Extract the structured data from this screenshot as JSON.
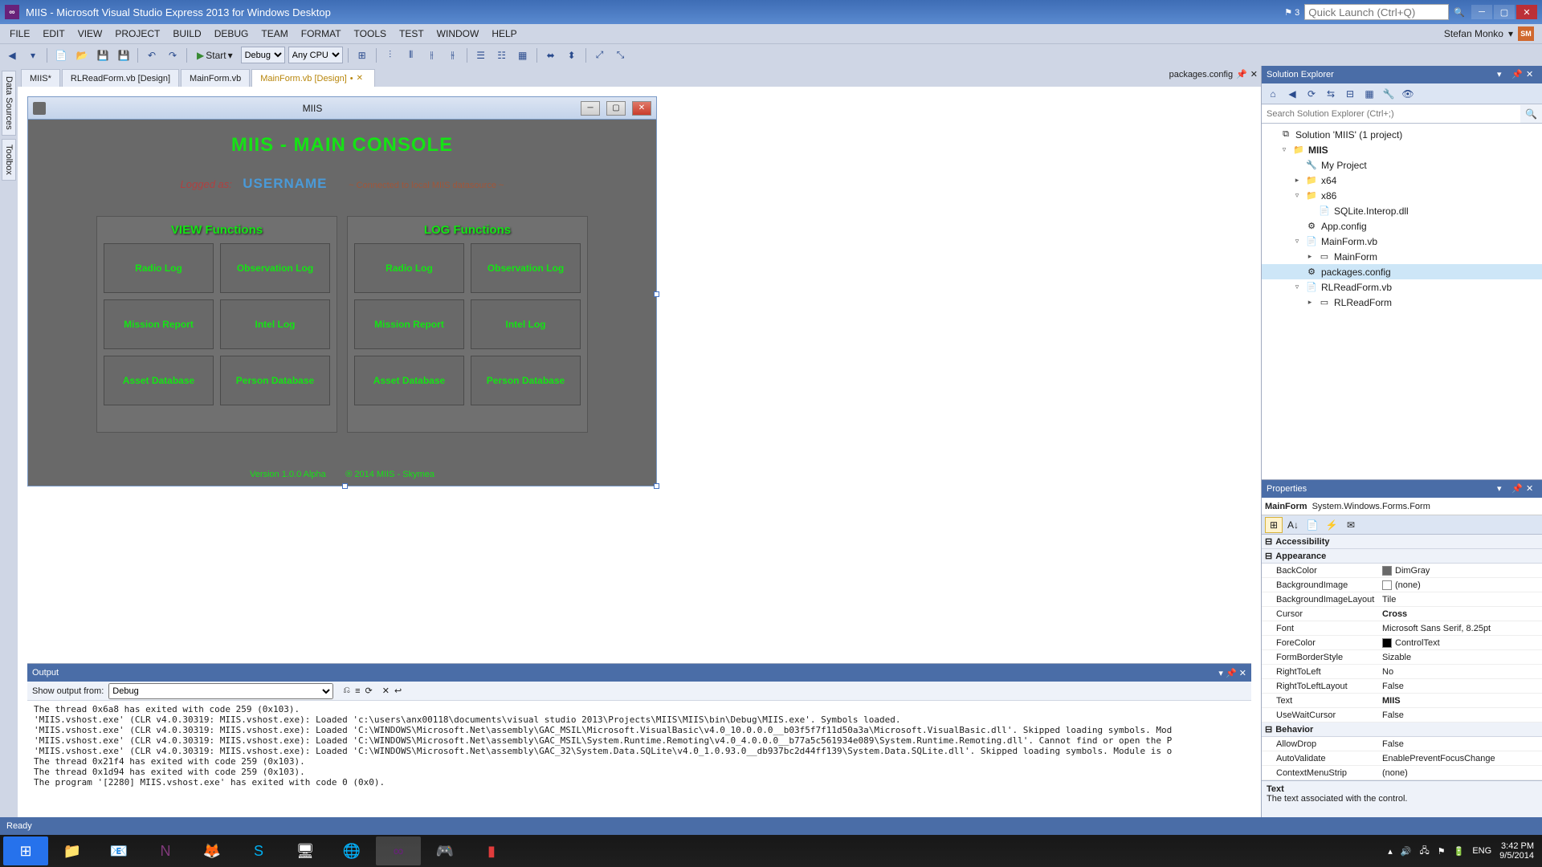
{
  "titlebar": {
    "title": "MIIS - Microsoft Visual Studio Express 2013 for Windows Desktop",
    "notif_count": "3",
    "quick_launch_placeholder": "Quick Launch (Ctrl+Q)"
  },
  "menubar": {
    "items": [
      "FILE",
      "EDIT",
      "VIEW",
      "PROJECT",
      "BUILD",
      "DEBUG",
      "TEAM",
      "FORMAT",
      "TOOLS",
      "TEST",
      "WINDOW",
      "HELP"
    ],
    "user": "Stefan Monko"
  },
  "toolbar": {
    "start": "Start",
    "config": "Debug",
    "platform": "Any CPU"
  },
  "side_tabs": [
    "Data Sources",
    "Toolbox"
  ],
  "doc_tabs": {
    "tabs": [
      {
        "label": "MIIS*"
      },
      {
        "label": "RLReadForm.vb [Design]"
      },
      {
        "label": "MainForm.vb"
      },
      {
        "label": "MainForm.vb [Design]",
        "active": true,
        "dirty": true
      }
    ],
    "right_file": "packages.config"
  },
  "form": {
    "title": "MIIS",
    "header": "MIIS - MAIN CONSOLE",
    "logged_as": "Logged as:",
    "username": "USERNAME",
    "datasource": "~ Connected to local MIIS datasource ~",
    "view_title": "VIEW Functions",
    "log_title": "LOG Functions",
    "buttons": [
      "Radio Log",
      "Observation Log",
      "Mission Report",
      "Intel Log",
      "Asset Database",
      "Person Database"
    ],
    "version": "Version 1.0.0 Alpha",
    "copyright": "® 2014 MIIS - Skymea"
  },
  "output": {
    "title": "Output",
    "show_label": "Show output from:",
    "source": "Debug",
    "lines": [
      "The thread 0x6a8 has exited with code 259 (0x103).",
      "'MIIS.vshost.exe' (CLR v4.0.30319: MIIS.vshost.exe): Loaded 'c:\\users\\anx00118\\documents\\visual studio 2013\\Projects\\MIIS\\MIIS\\bin\\Debug\\MIIS.exe'. Symbols loaded.",
      "'MIIS.vshost.exe' (CLR v4.0.30319: MIIS.vshost.exe): Loaded 'C:\\WINDOWS\\Microsoft.Net\\assembly\\GAC_MSIL\\Microsoft.VisualBasic\\v4.0_10.0.0.0__b03f5f7f11d50a3a\\Microsoft.VisualBasic.dll'. Skipped loading symbols. Mod",
      "'MIIS.vshost.exe' (CLR v4.0.30319: MIIS.vshost.exe): Loaded 'C:\\WINDOWS\\Microsoft.Net\\assembly\\GAC_MSIL\\System.Runtime.Remoting\\v4.0_4.0.0.0__b77a5c561934e089\\System.Runtime.Remoting.dll'. Cannot find or open the P",
      "'MIIS.vshost.exe' (CLR v4.0.30319: MIIS.vshost.exe): Loaded 'C:\\WINDOWS\\Microsoft.Net\\assembly\\GAC_32\\System.Data.SQLite\\v4.0_1.0.93.0__db937bc2d44ff139\\System.Data.SQLite.dll'. Skipped loading symbols. Module is o",
      "The thread 0x21f4 has exited with code 259 (0x103).",
      "The thread 0x1d94 has exited with code 259 (0x103).",
      "The program '[2280] MIIS.vshost.exe' has exited with code 0 (0x0)."
    ]
  },
  "solution_explorer": {
    "title": "Solution Explorer",
    "search_placeholder": "Search Solution Explorer (Ctrl+;)",
    "tree": [
      {
        "depth": 0,
        "exp": "",
        "ico": "⧉",
        "label": "Solution 'MIIS' (1 project)"
      },
      {
        "depth": 1,
        "exp": "▿",
        "ico": "📁",
        "label": "MIIS",
        "bold": true
      },
      {
        "depth": 2,
        "exp": "",
        "ico": "🔧",
        "label": "My Project"
      },
      {
        "depth": 2,
        "exp": "▸",
        "ico": "📁",
        "label": "x64"
      },
      {
        "depth": 2,
        "exp": "▿",
        "ico": "📁",
        "label": "x86"
      },
      {
        "depth": 3,
        "exp": "",
        "ico": "📄",
        "label": "SQLite.Interop.dll"
      },
      {
        "depth": 2,
        "exp": "",
        "ico": "⚙",
        "label": "App.config"
      },
      {
        "depth": 2,
        "exp": "▿",
        "ico": "📄",
        "label": "MainForm.vb"
      },
      {
        "depth": 3,
        "exp": "▸",
        "ico": "▭",
        "label": "MainForm"
      },
      {
        "depth": 2,
        "exp": "",
        "ico": "⚙",
        "label": "packages.config",
        "selected": true
      },
      {
        "depth": 2,
        "exp": "▿",
        "ico": "📄",
        "label": "RLReadForm.vb"
      },
      {
        "depth": 3,
        "exp": "▸",
        "ico": "▭",
        "label": "RLReadForm"
      }
    ]
  },
  "properties": {
    "title": "Properties",
    "selection_name": "MainForm",
    "selection_type": "System.Windows.Forms.Form",
    "cats": [
      {
        "name": "Accessibility",
        "rows": []
      },
      {
        "name": "Appearance",
        "rows": [
          {
            "n": "BackColor",
            "v": "DimGray",
            "swatch": "#696969"
          },
          {
            "n": "BackgroundImage",
            "v": "(none)",
            "swatch": "#ffffff"
          },
          {
            "n": "BackgroundImageLayout",
            "v": "Tile"
          },
          {
            "n": "Cursor",
            "v": "Cross",
            "bold": true
          },
          {
            "n": "Font",
            "v": "Microsoft Sans Serif, 8.25pt"
          },
          {
            "n": "ForeColor",
            "v": "ControlText",
            "swatch": "#000000"
          },
          {
            "n": "FormBorderStyle",
            "v": "Sizable"
          },
          {
            "n": "RightToLeft",
            "v": "No"
          },
          {
            "n": "RightToLeftLayout",
            "v": "False"
          },
          {
            "n": "Text",
            "v": "MIIS",
            "bold": true
          },
          {
            "n": "UseWaitCursor",
            "v": "False"
          }
        ]
      },
      {
        "name": "Behavior",
        "rows": [
          {
            "n": "AllowDrop",
            "v": "False"
          },
          {
            "n": "AutoValidate",
            "v": "EnablePreventFocusChange"
          },
          {
            "n": "ContextMenuStrip",
            "v": "(none)"
          }
        ]
      }
    ],
    "help_title": "Text",
    "help_text": "The text associated with the control."
  },
  "statusbar": {
    "text": "Ready"
  },
  "taskbar": {
    "time": "3:42 PM",
    "date": "9/5/2014",
    "lang": "ENG"
  }
}
